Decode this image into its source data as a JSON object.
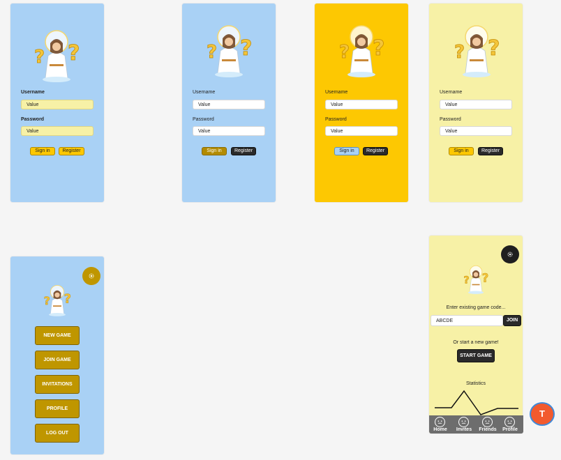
{
  "login_screens": [
    {
      "username_label": "Username",
      "username_value": "Value",
      "password_label": "Password",
      "password_value": "Value",
      "signin_label": "Sign in",
      "register_label": "Register"
    },
    {
      "username_label": "Username",
      "username_value": "Value",
      "password_label": "Password",
      "password_value": "Value",
      "signin_label": "Sign in",
      "register_label": "Register"
    },
    {
      "username_label": "Username",
      "username_value": "Value",
      "password_label": "Password",
      "password_value": "Value",
      "signin_label": "Sign in",
      "register_label": "Register"
    },
    {
      "username_label": "Username",
      "username_value": "Value",
      "password_label": "Password",
      "password_value": "Value",
      "signin_label": "Sign in",
      "register_label": "Register"
    }
  ],
  "menu_screen": {
    "buttons": [
      "NEW GAME",
      "JOIN GAME",
      "INVITATIONS",
      "PROFILE",
      "LOG OUT"
    ]
  },
  "game_screen": {
    "enter_code_text": "Enter existing game code...",
    "code_value": "ABCDE",
    "join_label": "JOIN",
    "or_start_text": "Or start a new game!",
    "start_game_label": "START GAME",
    "statistics_label": "Statistics",
    "nav": [
      "Home",
      "Invites",
      "Friends",
      "Profile"
    ]
  },
  "fab_label": "T",
  "colors": {
    "blue_bg": "#a9d1f5",
    "gold_bg": "#fdc802",
    "cream_bg": "#f7f1a6",
    "menu_button": "#bf9600",
    "dark": "#2a2a2a",
    "fab": "#f25a2e"
  },
  "icons": {
    "settings": "gear-icon",
    "nav": "neutral-face-icon",
    "avatar": "jesus-question-marks-illustration"
  }
}
